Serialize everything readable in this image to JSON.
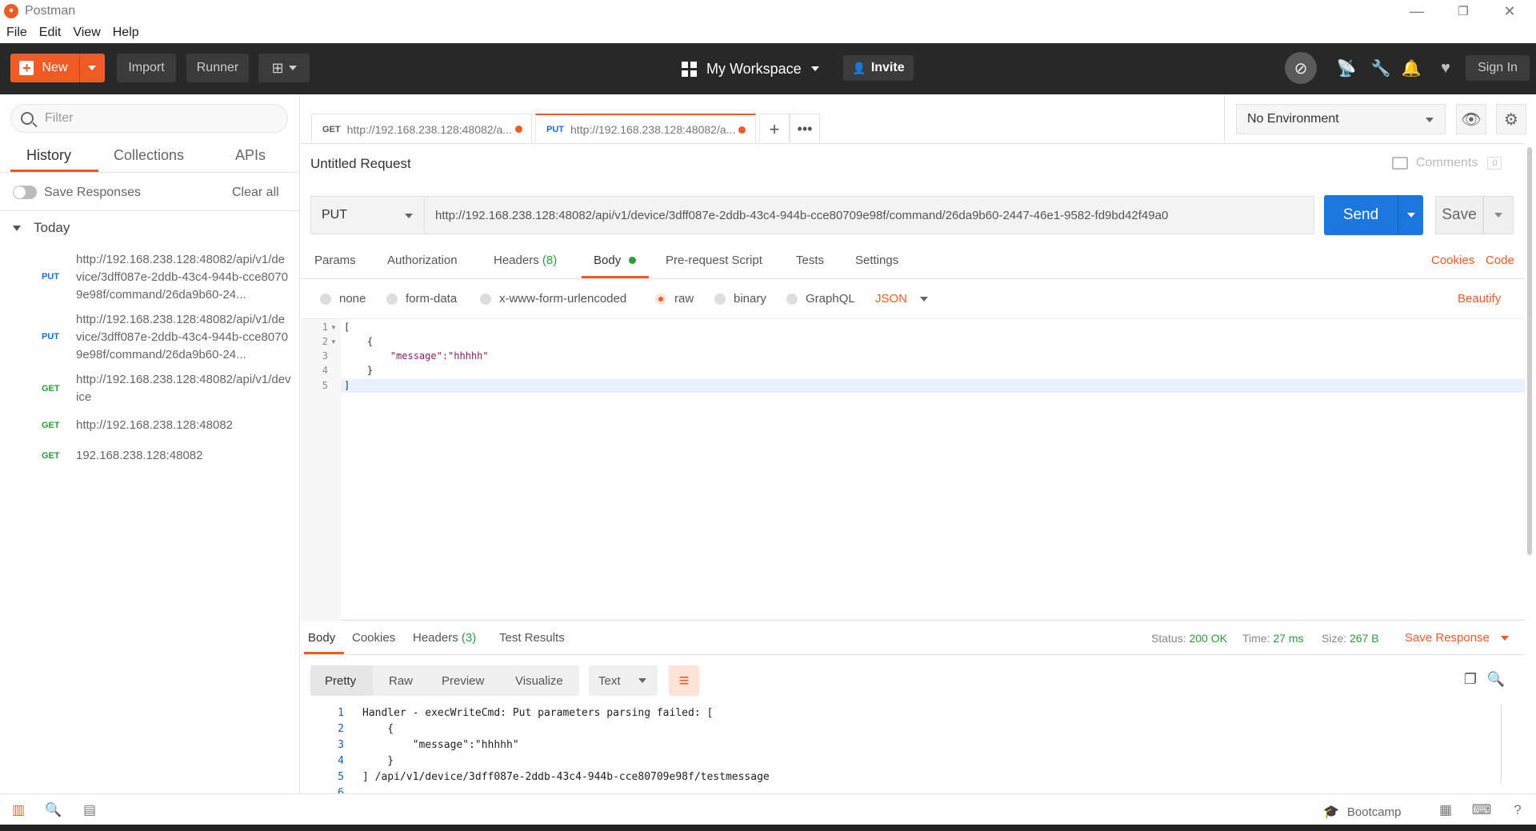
{
  "window": {
    "app_title": "Postman",
    "minimize": "—",
    "restore": "❐",
    "close": "✕"
  },
  "menu": [
    "File",
    "Edit",
    "View",
    "Help"
  ],
  "header": {
    "new_label": "New",
    "import_label": "Import",
    "runner_label": "Runner",
    "workspace_label": "My Workspace",
    "invite_label": "Invite",
    "signin_label": "Sign In"
  },
  "sidebar": {
    "filter_placeholder": "Filter",
    "tabs": [
      "History",
      "Collections",
      "APIs"
    ],
    "save_responses_label": "Save Responses",
    "clear_all_label": "Clear all",
    "group_label": "Today",
    "history": [
      {
        "method": "PUT",
        "url": "http://192.168.238.128:48082/api/v1/device/3dff087e-2ddb-43c4-944b-cce80709e98f/command/26da9b60-24..."
      },
      {
        "method": "PUT",
        "url": "http://192.168.238.128:48082/api/v1/device/3dff087e-2ddb-43c4-944b-cce80709e98f/command/26da9b60-24..."
      },
      {
        "method": "GET",
        "url": "http://192.168.238.128:48082/api/v1/device"
      },
      {
        "method": "GET",
        "url": "http://192.168.238.128:48082"
      },
      {
        "method": "GET",
        "url": "192.168.238.128:48082"
      }
    ]
  },
  "request_tabs": [
    {
      "method": "GET",
      "label": "http://192.168.238.128:48082/a..."
    },
    {
      "method": "PUT",
      "label": "http://192.168.238.128:48082/a..."
    }
  ],
  "environment": {
    "selected": "No Environment"
  },
  "request": {
    "title": "Untitled Request",
    "comments_label": "Comments",
    "comments_count": "0",
    "method": "PUT",
    "url": "http://192.168.238.128:48082/api/v1/device/3dff087e-2ddb-43c4-944b-cce80709e98f/command/26da9b60-2447-46e1-9582-fd9bd42f49a0",
    "send_label": "Send",
    "save_label": "Save",
    "tabs": {
      "params": "Params",
      "authorization": "Authorization",
      "headers": "Headers",
      "headers_count": "(8)",
      "body": "Body",
      "prerequest": "Pre-request Script",
      "tests": "Tests",
      "settings": "Settings"
    },
    "cookies_link": "Cookies",
    "code_link": "Code",
    "body_types": [
      "none",
      "form-data",
      "x-www-form-urlencoded",
      "raw",
      "binary",
      "GraphQL"
    ],
    "body_format": "JSON",
    "beautify_label": "Beautify",
    "body_lines": [
      "[",
      "    {",
      "        \"message\":\"hhhhh\"",
      "    }",
      "]"
    ]
  },
  "response": {
    "tabs": {
      "body": "Body",
      "cookies": "Cookies",
      "headers": "Headers",
      "headers_count": "(3)",
      "tests": "Test Results"
    },
    "status_label": "Status:",
    "status_value": "200 OK",
    "time_label": "Time:",
    "time_value": "27 ms",
    "size_label": "Size:",
    "size_value": "267 B",
    "save_response_label": "Save Response",
    "views": [
      "Pretty",
      "Raw",
      "Preview",
      "Visualize"
    ],
    "format": "Text",
    "lines": [
      "Handler - execWriteCmd: Put parameters parsing failed: [",
      "    {",
      "        \"message\":\"hhhhh\"",
      "    }",
      "] /api/v1/device/3dff087e-2ddb-43c4-944b-cce80709e98f/testmessage",
      ""
    ]
  },
  "footer": {
    "bootcamp_label": "Bootcamp"
  },
  "colors": {
    "accent": "#ef5b25",
    "primary": "#1b76de",
    "success": "#2a9d3a",
    "header_bg": "#282828"
  }
}
